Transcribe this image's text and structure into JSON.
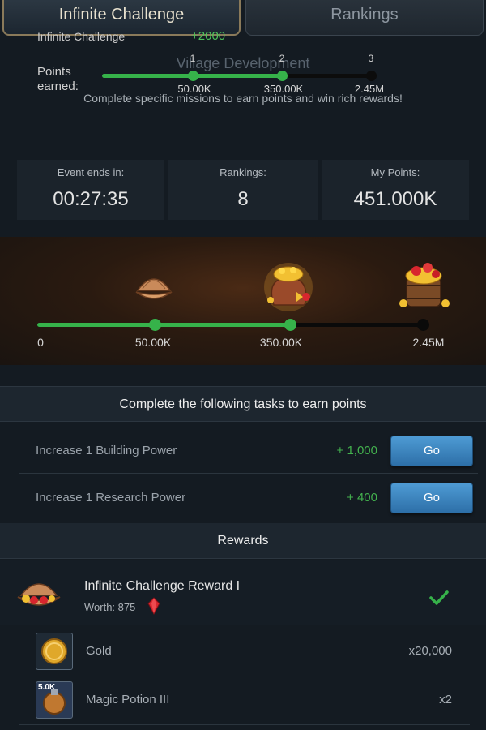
{
  "tabs": [
    {
      "label": "Infinite Challenge",
      "active": true
    },
    {
      "label": "Rankings",
      "active": false
    }
  ],
  "overlay": {
    "title": "Infinite Challenge",
    "bonus": "+2000",
    "points_label": "Points earned:",
    "steps": [
      "1",
      "2",
      "3"
    ],
    "values": [
      "50.00K",
      "350.00K",
      "2.45M"
    ]
  },
  "header": {
    "title": "Village Development",
    "subtitle": "Complete specific missions to earn points and win rich rewards!"
  },
  "stats": [
    {
      "label": "Event ends in:",
      "value": "00:27:35"
    },
    {
      "label": "Rankings:",
      "value": "8"
    },
    {
      "label": "My Points:",
      "value": "451.000K"
    }
  ],
  "milestones": {
    "values": [
      "0",
      "50.00K",
      "350.00K",
      "2.45M"
    ],
    "icons": [
      "shell-chest-icon",
      "treasure-bag-icon",
      "treasure-barrel-icon"
    ]
  },
  "tasks": {
    "header": "Complete the following tasks to earn points",
    "items": [
      {
        "label": "Increase 1 Building Power",
        "points": "+ 1,000",
        "button": "Go"
      },
      {
        "label": "Increase 1 Research Power",
        "points": "+ 400",
        "button": "Go"
      }
    ]
  },
  "rewards": {
    "header": "Rewards",
    "main": {
      "name": "Infinite Challenge Reward I",
      "worth": "Worth: 875",
      "claimed": true
    },
    "items": [
      {
        "name": "Gold",
        "qty": "x20,000",
        "icon": "gold-coin-icon",
        "badge": ""
      },
      {
        "name": "Magic Potion III",
        "qty": "x2",
        "icon": "magic-potion-icon",
        "badge": "5.0K"
      }
    ]
  },
  "colors": {
    "accent_green": "#36b24a",
    "button_blue": "#3d86c2",
    "gem_red": "#d8262e"
  }
}
